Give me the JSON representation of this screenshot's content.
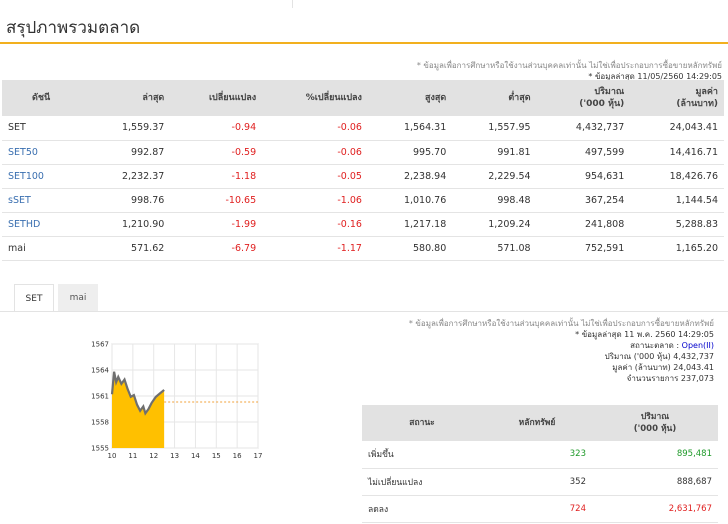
{
  "page": {
    "title": "สรุปภาพรวมตลาด"
  },
  "top_note": {
    "disclaimer": "* ข้อมูลเพื่อการศึกษาหรือใช้งานส่วนบุคคลเท่านั้น ไม่ใช่เพื่อประกอบการซื้อขายหลักทรัพย์",
    "updated": "* ข้อมูลล่าสุด 11/05/2560 14:29:05"
  },
  "summary_table": {
    "headers": [
      "ดัชนี",
      "ล่าสุด",
      "เปลี่ยนแปลง",
      "%เปลี่ยนแปลง",
      "สูงสุด",
      "ต่ำสุด",
      "ปริมาณ\n('000 หุ้น)",
      "มูลค่า\n(ล้านบาท)"
    ],
    "rows": [
      {
        "name": "SET",
        "last": "1,559.37",
        "change": "-0.94",
        "pct": "-0.06",
        "high": "1,564.31",
        "low": "1,557.95",
        "volume": "4,432,737",
        "value": "24,043.41"
      },
      {
        "name": "SET50",
        "last": "992.87",
        "change": "-0.59",
        "pct": "-0.06",
        "high": "995.70",
        "low": "991.81",
        "volume": "497,599",
        "value": "14,416.71"
      },
      {
        "name": "SET100",
        "last": "2,232.37",
        "change": "-1.18",
        "pct": "-0.05",
        "high": "2,238.94",
        "low": "2,229.54",
        "volume": "954,631",
        "value": "18,426.76"
      },
      {
        "name": "sSET",
        "last": "998.76",
        "change": "-10.65",
        "pct": "-1.06",
        "high": "1,010.76",
        "low": "998.48",
        "volume": "367,254",
        "value": "1,144.54"
      },
      {
        "name": "SETHD",
        "last": "1,210.90",
        "change": "-1.99",
        "pct": "-0.16",
        "high": "1,217.18",
        "low": "1,209.24",
        "volume": "241,808",
        "value": "5,288.83"
      },
      {
        "name": "mai",
        "last": "571.62",
        "change": "-6.79",
        "pct": "-1.17",
        "high": "580.80",
        "low": "571.08",
        "volume": "752,591",
        "value": "1,165.20"
      }
    ]
  },
  "tabs": [
    {
      "label": "SET"
    },
    {
      "label": "mai"
    }
  ],
  "market_info": {
    "disclaimer": "* ข้อมูลเพื่อการศึกษาหรือใช้งานส่วนบุคคลเท่านั้น ไม่ใช่เพื่อประกอบการซื้อขายหลักทรัพย์",
    "updated": "* ข้อมูลล่าสุด 11 พ.ค. 2560 14:29:05",
    "status_label": "สถานะตลาด :",
    "status_value": "Open(II)",
    "volume_label": "ปริมาณ ('000 หุ้น)",
    "volume_value": "4,432,737",
    "value_label": "มูลค่า (ล้านบาท)",
    "value_value": "24,043.41",
    "deals_label": "จำนวนรายการ",
    "deals_value": "237,073"
  },
  "breadth_table": {
    "headers": [
      "สถานะ",
      "หลักทรัพย์",
      "ปริมาณ\n('000 หุ้น)"
    ],
    "rows": [
      {
        "status": "เพิ่มขึ้น",
        "count": "323",
        "volume": "895,481"
      },
      {
        "status": "ไม่เปลี่ยนแปลง",
        "count": "352",
        "volume": "888,687"
      },
      {
        "status": "ลดลง",
        "count": "724",
        "volume": "2,631,767"
      }
    ]
  },
  "chart_data": {
    "type": "area",
    "xticks": [
      "10",
      "11",
      "12",
      "13",
      "14",
      "15",
      "16",
      "17"
    ],
    "yticks": [
      "1567",
      "1564",
      "1561",
      "1558",
      "1555"
    ],
    "xlim": [
      10,
      17
    ],
    "ylim": [
      1555,
      1567
    ],
    "prev_close": 1560.31,
    "x": [
      10.0,
      10.1,
      10.2,
      10.3,
      10.45,
      10.6,
      10.75,
      10.9,
      11.05,
      11.2,
      11.35,
      11.5,
      11.6,
      11.75,
      11.9,
      12.1,
      12.3,
      12.5
    ],
    "y": [
      1561.2,
      1563.8,
      1562.6,
      1563.2,
      1562.4,
      1562.9,
      1561.8,
      1560.9,
      1561.1,
      1560.0,
      1559.3,
      1559.8,
      1559.0,
      1559.5,
      1560.2,
      1560.9,
      1561.3,
      1561.7
    ],
    "fill_color": "#ffc000",
    "line_color": "#6f6f6f",
    "ref_line_color": "#f2a23a",
    "grid": true
  }
}
